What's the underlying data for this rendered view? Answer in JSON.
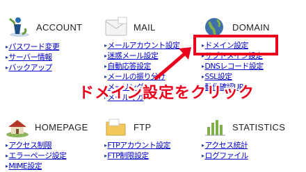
{
  "sections": {
    "account": {
      "title": "ACCOUNT",
      "icon": "info-person-icon",
      "links": [
        "パスワード変更",
        "サーバー情報",
        "バックアップ"
      ]
    },
    "mail": {
      "title": "MAIL",
      "icon": "envelope-icon",
      "links": [
        "メールアカウント設定",
        "迷惑メール設定",
        "自動応答設定",
        "メールの振り分け",
        "メーリング",
        "メールマガ"
      ]
    },
    "domain": {
      "title": "DOMAIN",
      "icon": "globe-icon",
      "links": [
        "ドメイン設定",
        "サブドメイン設定",
        "DNSレコード設定",
        "SSL設定",
        "動作確認URL"
      ]
    },
    "homepage": {
      "title": "HOMEPAGE",
      "icon": "house-icon",
      "links": [
        "アクセス制限",
        "エラーページ設定",
        "MIME設定"
      ]
    },
    "ftp": {
      "title": "FTP",
      "icon": "folder-icon",
      "links": [
        "FTPアカウント設定",
        "FTP制限設定"
      ]
    },
    "statistics": {
      "title": "STATISTICS",
      "icon": "bar-chart-icon",
      "links": [
        "アクセス統計",
        "ログファイル"
      ]
    }
  },
  "annotation": {
    "callout_text": "ドメイン設定をクリック",
    "highlight_color": "#e8001c"
  }
}
